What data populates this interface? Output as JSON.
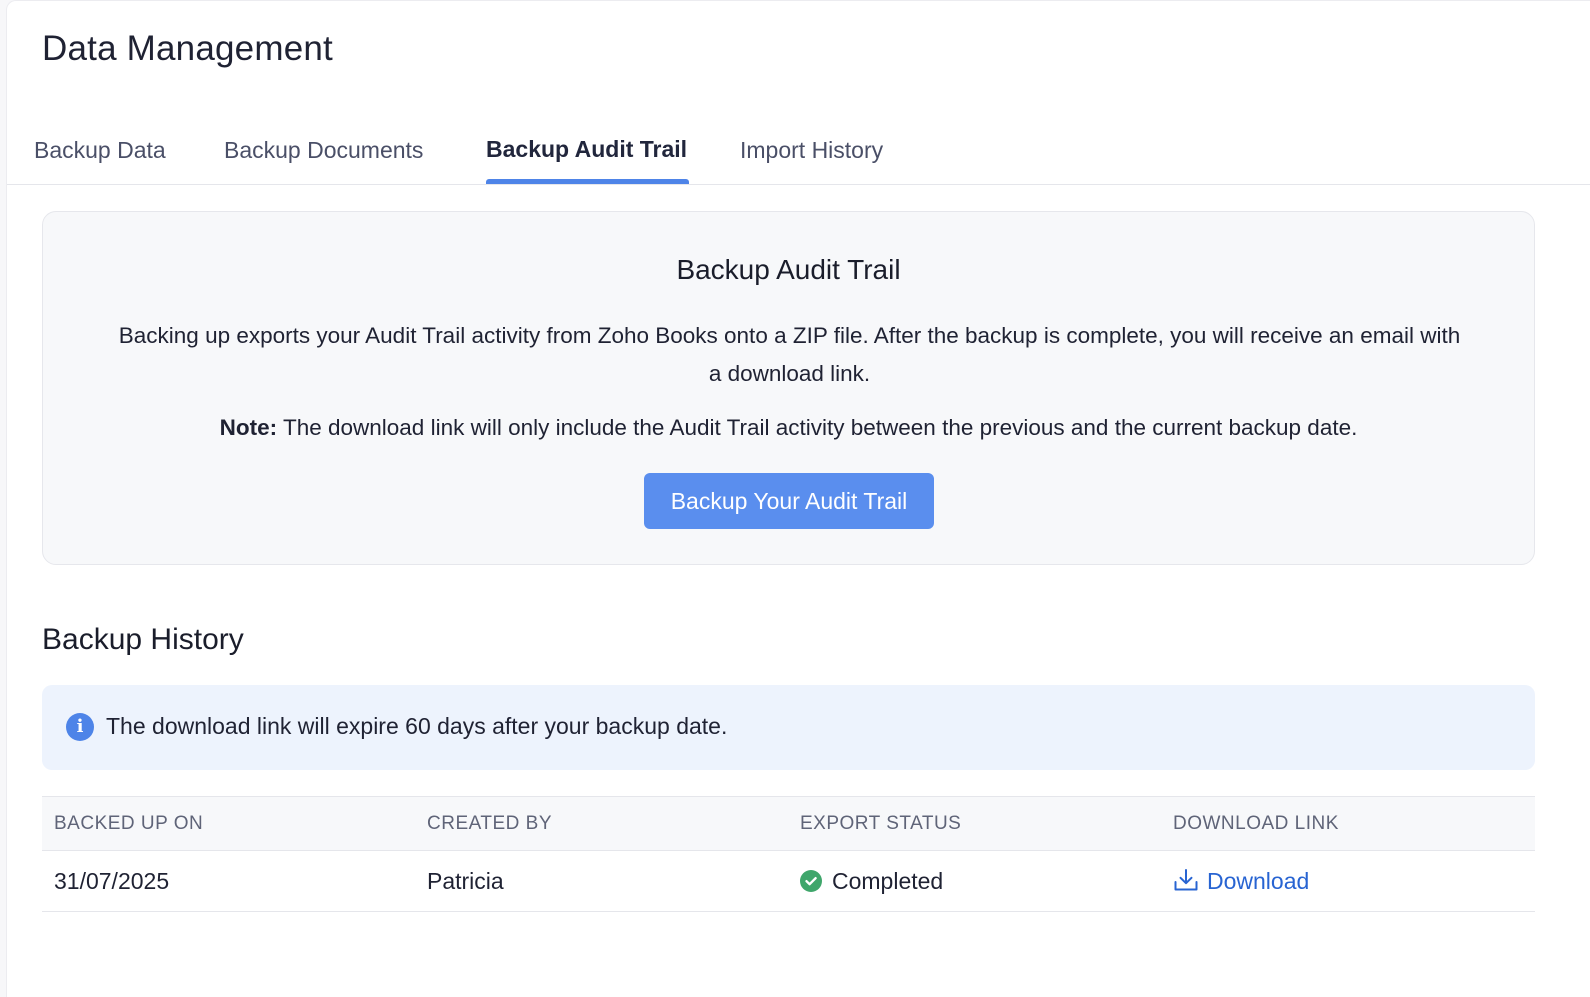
{
  "page": {
    "title": "Data Management"
  },
  "tabs": [
    {
      "label": "Backup Data",
      "active": false
    },
    {
      "label": "Backup Documents",
      "active": false
    },
    {
      "label": "Backup Audit Trail",
      "active": true
    },
    {
      "label": "Import History",
      "active": false
    }
  ],
  "card": {
    "title": "Backup Audit Trail",
    "description": "Backing up exports your Audit Trail activity from Zoho Books onto a ZIP file. After the backup is complete, you will receive an email with a download link.",
    "note_label": "Note:",
    "note_text": " The download link will only include the Audit Trail activity between the previous and the current backup date.",
    "button_label": "Backup Your Audit Trail"
  },
  "history": {
    "title": "Backup History",
    "banner_icon": "info-icon",
    "banner_icon_glyph": "i",
    "banner_text": "The download link will expire 60 days after your backup date.",
    "columns": [
      "BACKED UP ON",
      "CREATED BY",
      "EXPORT STATUS",
      "DOWNLOAD LINK"
    ],
    "rows": [
      {
        "backed_up_on": "31/07/2025",
        "created_by": "Patricia",
        "status": "Completed",
        "status_icon": "check-circle-icon",
        "download_label": "Download",
        "download_icon": "download-icon"
      }
    ]
  },
  "colors": {
    "accent": "#4e84e8",
    "button": "#5a8eee",
    "success": "#3fa66b",
    "link": "#2864d2",
    "banner_bg": "#edf3fd"
  }
}
